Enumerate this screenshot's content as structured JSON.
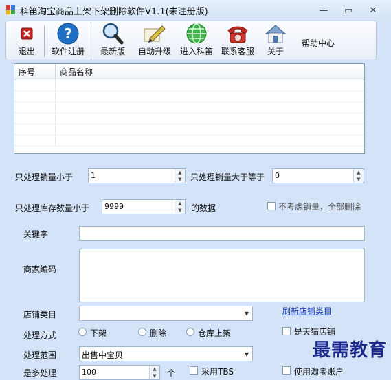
{
  "window": {
    "title": "科笛淘宝商品上架下架删除软件V1.1(未注册版)",
    "minimize": "—",
    "maximize": "▭",
    "close": "✕"
  },
  "toolbar": [
    {
      "label": "退出",
      "icon": "exit-icon"
    },
    {
      "label": "软件注册",
      "icon": "help-icon"
    },
    {
      "label": "最新版",
      "icon": "magnifier-icon"
    },
    {
      "label": "自动升级",
      "icon": "pen-icon"
    },
    {
      "label": "进入科笛",
      "icon": "globe-icon"
    },
    {
      "label": "联系客服",
      "icon": "phone-icon"
    },
    {
      "label": "关于",
      "icon": "house-icon"
    },
    {
      "label": "帮助中心",
      "icon": ""
    }
  ],
  "grid": {
    "columns": [
      "序号",
      "商品名称"
    ]
  },
  "form": {
    "sales_less_label": "只处理销量小于",
    "sales_less_value": "1",
    "sales_gte_label": "只处理销量大于等于",
    "sales_gte_value": "0",
    "stock_less_label": "只处理库存数量小于",
    "stock_less_value": "9999",
    "stock_suffix": "的数据",
    "ignore_sales_label": "不考虑销量，全部删除",
    "keyword_label": "关键字",
    "keyword_value": "",
    "merchant_code_label": "商家编码",
    "merchant_code_value": "",
    "store_category_label": "店铺类目",
    "store_category_value": "",
    "refresh_category_link": "刷新店铺类目",
    "method_label": "处理方式",
    "method_options": [
      "下架",
      "删除",
      "仓库上架"
    ],
    "tmall_label": "是天猫店铺",
    "scope_label": "处理范围",
    "scope_value": "出售中宝贝",
    "partial_row": {
      "label": "是多处理",
      "value": "100",
      "unit": "个",
      "check_label": "采用TBS",
      "account_label": "使用淘宝账户"
    }
  },
  "watermark": "最需教育"
}
